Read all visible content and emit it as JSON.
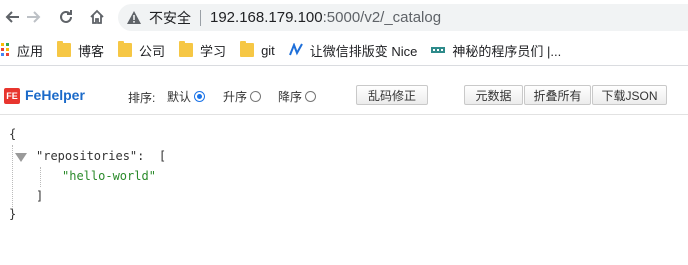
{
  "browser": {
    "security_label": "不安全",
    "url_host": "192.168.179.100",
    "url_rest": ":5000/v2/_catalog"
  },
  "bookmarks": [
    {
      "label": "应用",
      "icon": "apps-grid-icon"
    },
    {
      "label": "博客",
      "icon": "folder-icon"
    },
    {
      "label": "公司",
      "icon": "folder-icon"
    },
    {
      "label": "学习",
      "icon": "folder-icon"
    },
    {
      "label": "git",
      "icon": "folder-icon"
    },
    {
      "label": "让微信排版变 Nice",
      "icon": "nice-logo-icon"
    },
    {
      "label": "神秘的程序员们 |...",
      "icon": "site-favicon-icon"
    }
  ],
  "fehelper": {
    "logo_text": "FE",
    "title": "FeHelper",
    "sort_label": "排序:",
    "sort_options": [
      {
        "label": "默认",
        "selected": true
      },
      {
        "label": "升序",
        "selected": false
      },
      {
        "label": "降序",
        "selected": false
      }
    ],
    "buttons": {
      "fix_encoding": "乱码修正",
      "raw_data": "元数据",
      "collapse_all": "折叠所有",
      "download_json": "下载JSON"
    }
  },
  "json_view": {
    "open_brace": "{",
    "key": "\"repositories\"",
    "colon": ":",
    "open_bracket": "[",
    "items": [
      "\"hello-world\""
    ],
    "close_bracket": "]",
    "close_brace": "}"
  },
  "colors": {
    "fehelper_title": "#1b6ac9",
    "fehelper_logo": "#e8352e",
    "json_string": "#2a8a2a",
    "radio_selected": "#1a73e8"
  }
}
